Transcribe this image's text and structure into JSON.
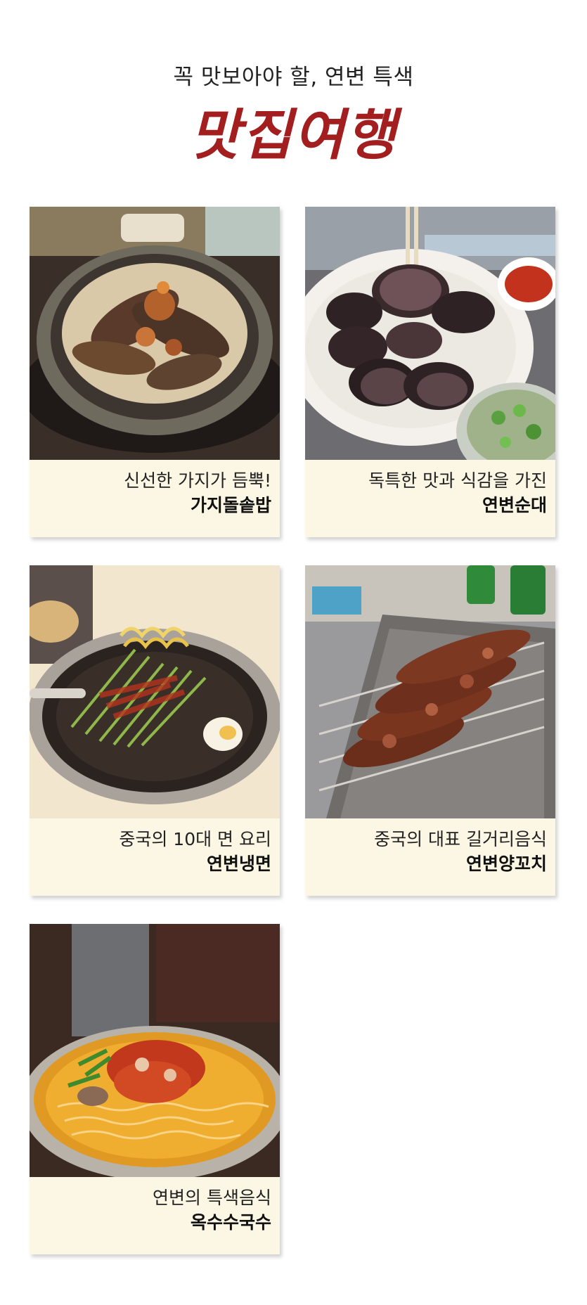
{
  "header": {
    "subtitle": "꼭 맛보아야 할, 연변 특색",
    "title": "맛집여행"
  },
  "cards": [
    {
      "line1": "신선한 가지가 듬뿍!",
      "line2": "가지돌솥밥",
      "photo": "eggplant-stone-pot-rice-photo"
    },
    {
      "line1": "독특한 맛과 식감을 가진",
      "line2": "연변순대",
      "photo": "sundae-sausage-photo"
    },
    {
      "line1": "중국의 10대 면 요리",
      "line2": "연변냉면",
      "photo": "cold-noodles-photo"
    },
    {
      "line1": "중국의 대표 길거리음식",
      "line2": "연변양꼬치",
      "photo": "lamb-skewers-photo"
    },
    {
      "line1": "연변의 특색음식",
      "line2": "옥수수국수",
      "photo": "corn-noodle-soup-photo"
    }
  ]
}
